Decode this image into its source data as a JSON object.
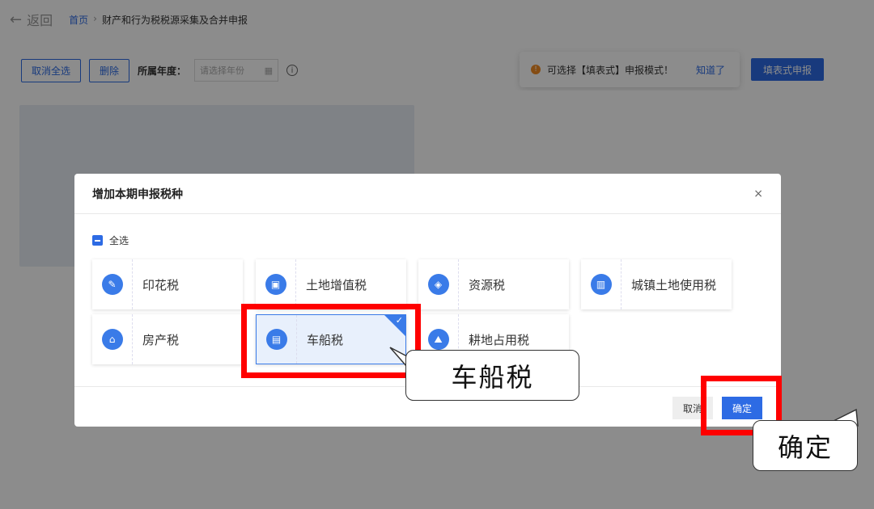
{
  "topbar": {
    "back_label": "返回",
    "breadcrumb_home": "首页",
    "breadcrumb_sep": "›",
    "breadcrumb_current": "财产和行为税税源采集及合并申报"
  },
  "toolbar": {
    "cancel_all": "取消全选",
    "delete": "删除",
    "year_label": "所属年度：",
    "year_placeholder": "请选择年份",
    "info": "i",
    "fill_form_button": "填表式申报"
  },
  "notice": {
    "icon": "!",
    "text": "可选择【填表式】申报模式！",
    "link": "知道了"
  },
  "modal": {
    "title": "增加本期申报税种",
    "close": "×",
    "select_all": "全选",
    "taxes": [
      {
        "label": "印花税",
        "icon": "stamp-icon",
        "selected": false
      },
      {
        "label": "土地增值税",
        "icon": "land-icon",
        "selected": false
      },
      {
        "label": "资源税",
        "icon": "resource-icon",
        "selected": false
      },
      {
        "label": "城镇土地使用税",
        "icon": "building-icon",
        "selected": false
      },
      {
        "label": "房产税",
        "icon": "house-icon",
        "selected": false
      },
      {
        "label": "车船税",
        "icon": "vehicle-icon",
        "selected": true
      },
      {
        "label": "耕地占用税",
        "icon": "farmland-icon",
        "selected": false
      }
    ],
    "cancel": "取消",
    "confirm": "确定"
  },
  "annotations": {
    "callout_tax": "车船税",
    "callout_confirm": "确定",
    "highlight_color": "#ff0000"
  },
  "colors": {
    "primary": "#2d6be4"
  }
}
